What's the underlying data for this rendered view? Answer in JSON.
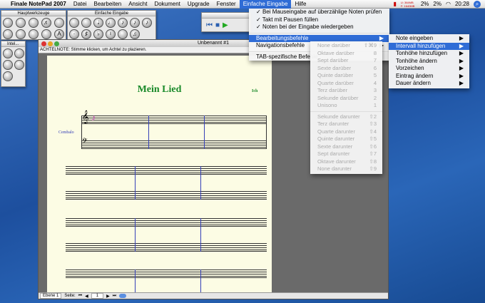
{
  "menubar": {
    "app": "Finale NotePad 2007",
    "items": [
      "Datei",
      "Bearbeiten",
      "Ansicht",
      "Dokument",
      "Upgrade",
      "Fenster",
      "Einfache Eingabe",
      "Hilfe"
    ],
    "active": "Einfache Eingabe",
    "status": {
      "mem": "U: 364MB F: 1640MB",
      "cpu1": "2%",
      "cpu2": "2%",
      "clock": "20:28"
    }
  },
  "palettes": {
    "main": "Hauptwerkzeuge",
    "simple": "Einfache Eingabe",
    "intel": "Intel..."
  },
  "document": {
    "title": "Unbenannt #1",
    "hint": "ACHTELNOTE: Stimme klicken, um Achtel zu plazieren.",
    "score_title": "Mein Lied",
    "composer": "Ich",
    "instrument": "Cembalo",
    "bottom": {
      "layer": "Ebene 1",
      "page_label": "Seite:",
      "page": "1"
    }
  },
  "menu": {
    "checked": [
      "Bei Mauseingabe auf überzählige Noten prüfen",
      "Takt mit Pausen füllen",
      "Noten bei der Eingabe wiedergeben"
    ],
    "submenus": [
      "Bearbeitungsbefehle",
      "Navigationsbefehle"
    ],
    "tab": "TAB-spezifische Befehle"
  },
  "submenu": [
    {
      "label": "Note eingeben"
    },
    {
      "label": "Intervall hinzufügen"
    },
    {
      "label": "Tonhöhe hinzufügen"
    },
    {
      "label": "Tonhöhe ändern"
    },
    {
      "label": "Vorzeichen"
    },
    {
      "label": "Eintrag ändern"
    },
    {
      "label": "Dauer ändern"
    }
  ],
  "intervals_up": [
    {
      "label": "None darüber",
      "key": "⇧⌘9"
    },
    {
      "label": "Oktave darüber",
      "key": "8"
    },
    {
      "label": "Sept darüber",
      "key": "7"
    },
    {
      "label": "Sexte darüber",
      "key": "6"
    },
    {
      "label": "Quinte darüber",
      "key": "5"
    },
    {
      "label": "Quarte darüber",
      "key": "4"
    },
    {
      "label": "Terz darüber",
      "key": "3"
    },
    {
      "label": "Sekunde darüber",
      "key": "2"
    },
    {
      "label": "Unisono",
      "key": "1"
    }
  ],
  "intervals_down": [
    {
      "label": "Sekunde darunter",
      "key": "⇧2"
    },
    {
      "label": "Terz darunter",
      "key": "⇧3"
    },
    {
      "label": "Quarte darunter",
      "key": "⇧4"
    },
    {
      "label": "Quinte darunter",
      "key": "⇧5"
    },
    {
      "label": "Sexte darunter",
      "key": "⇧6"
    },
    {
      "label": "Sept darunter",
      "key": "⇧7"
    },
    {
      "label": "Oktave darunter",
      "key": "⇧8"
    },
    {
      "label": "None darunter",
      "key": "⇧9"
    }
  ]
}
